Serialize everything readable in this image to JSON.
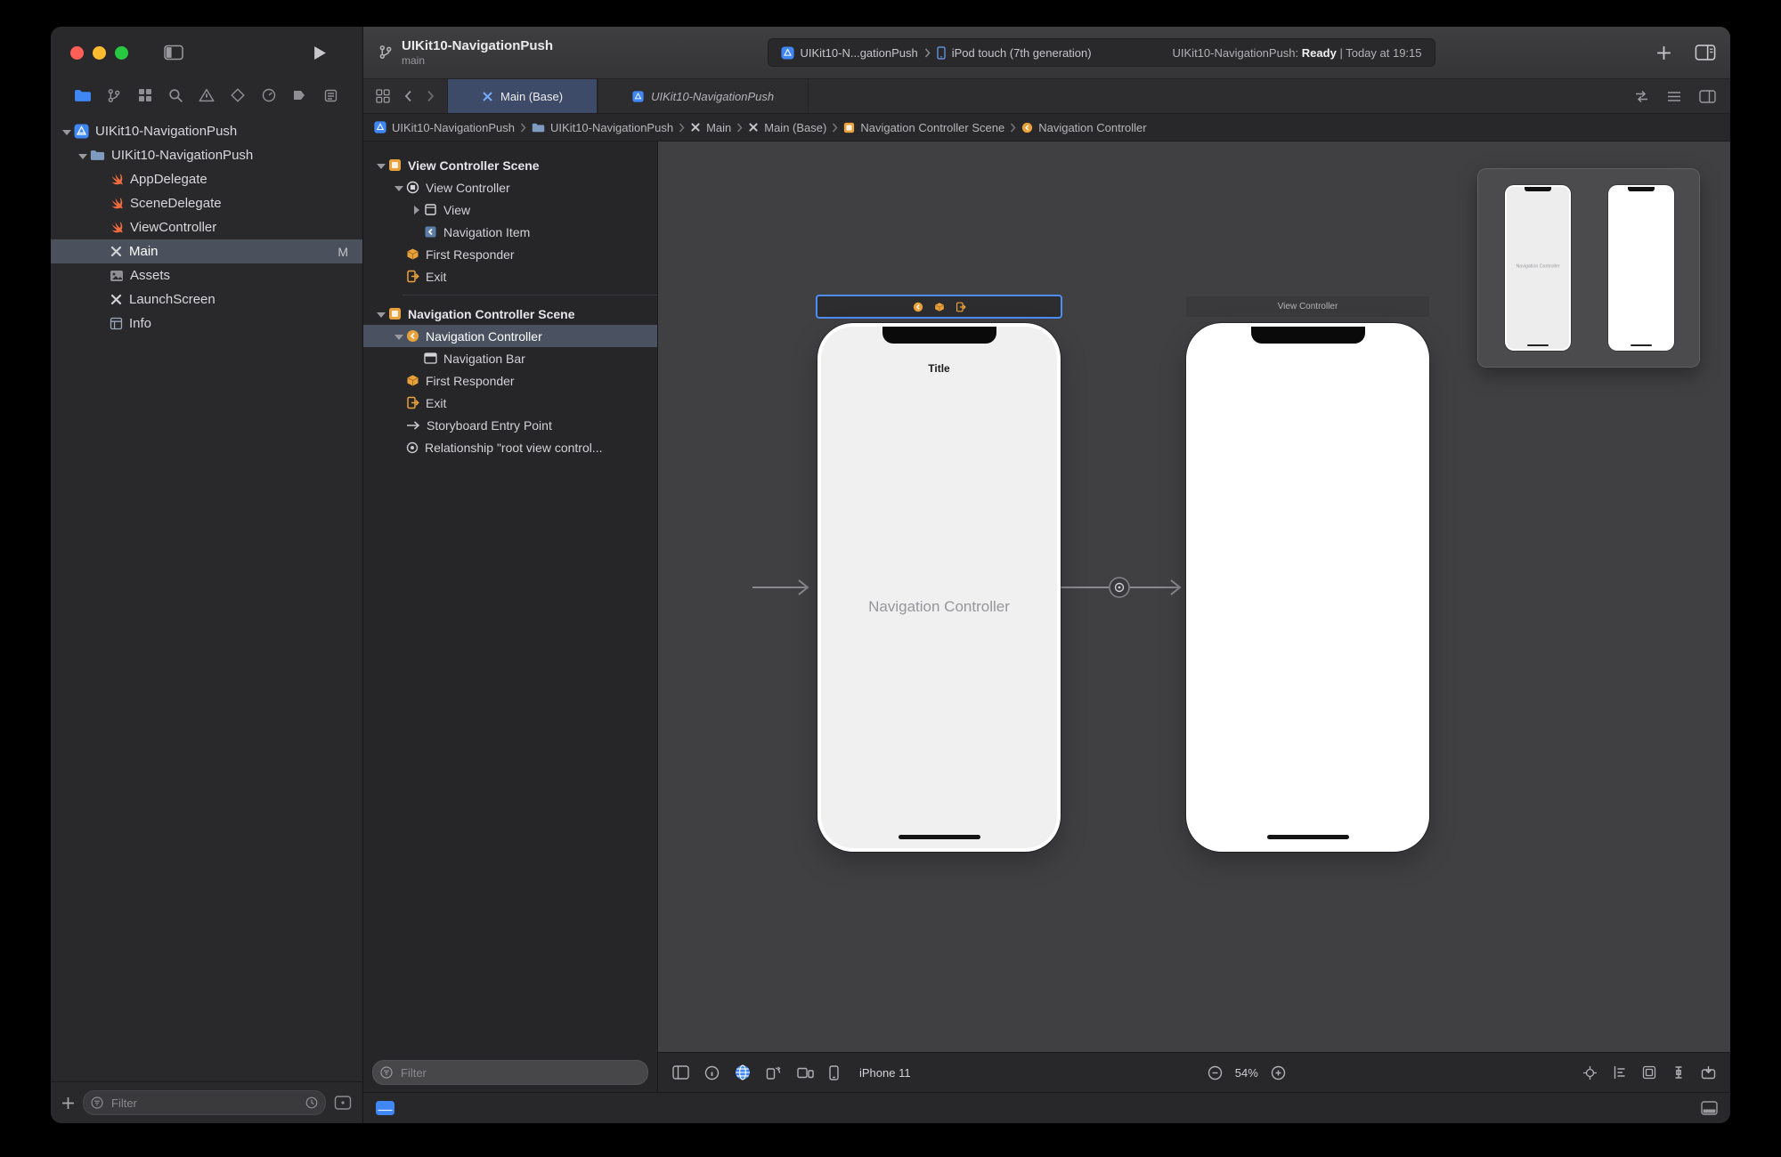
{
  "colors": {
    "accent_blue": "#3f87f5",
    "xcode_orange": "#e9a23b",
    "selection_blue": "#4d8df6",
    "swift_orange": "#f26b3e"
  },
  "sidebar": {
    "navigator_tabs": [
      "project-navigator-icon",
      "source-control-navigator-icon",
      "symbol-navigator-icon",
      "find-navigator-icon",
      "issue-navigator-icon",
      "test-navigator-icon",
      "debug-navigator-icon",
      "breakpoint-navigator-icon",
      "report-navigator-icon"
    ],
    "tree": [
      {
        "label": "UIKit10-NavigationPush",
        "icon": "xcode-project-icon"
      },
      {
        "label": "UIKit10-NavigationPush",
        "icon": "folder-icon"
      },
      {
        "label": "AppDelegate",
        "icon": "swift-file-icon"
      },
      {
        "label": "SceneDelegate",
        "icon": "swift-file-icon"
      },
      {
        "label": "ViewController",
        "icon": "swift-file-icon"
      },
      {
        "label": "Main",
        "icon": "storyboard-file-icon",
        "badge": "M",
        "selected": true
      },
      {
        "label": "Assets",
        "icon": "asset-catalog-icon"
      },
      {
        "label": "LaunchScreen",
        "icon": "storyboard-file-icon"
      },
      {
        "label": "Info",
        "icon": "plist-file-icon"
      }
    ],
    "filter_placeholder": "Filter"
  },
  "toolbar": {
    "title": "UIKit10-NavigationPush",
    "subtitle": "main",
    "scheme": "UIKit10-N...gationPush",
    "run_destination": "iPod touch (7th generation)",
    "activity_project": "UIKit10-NavigationPush:",
    "activity_status": "Ready",
    "activity_divider": "|",
    "activity_time": "Today at 19:15"
  },
  "tabbar": {
    "tabs": [
      {
        "label": "Main (Base)",
        "icon": "storyboard-file-icon",
        "active": true
      },
      {
        "label": "UIKit10-NavigationPush",
        "icon": "project-file-icon",
        "italic": true
      }
    ]
  },
  "jumpbar": {
    "crumbs": [
      {
        "label": "UIKit10-NavigationPush",
        "icon": "xcode-project-icon"
      },
      {
        "label": "UIKit10-NavigationPush",
        "icon": "folder-icon"
      },
      {
        "label": "Main",
        "icon": "storyboard-file-icon"
      },
      {
        "label": "Main (Base)",
        "icon": "storyboard-file-icon"
      },
      {
        "label": "Navigation Controller Scene",
        "icon": "scene-icon"
      },
      {
        "label": "Navigation Controller",
        "icon": "navigation-controller-icon"
      }
    ]
  },
  "outline": {
    "rows": [
      {
        "label": "View Controller Scene",
        "icon": "scene-icon"
      },
      {
        "label": "View Controller",
        "icon": "view-controller-icon"
      },
      {
        "label": "View",
        "icon": "view-icon"
      },
      {
        "label": "Navigation Item",
        "icon": "navigation-item-icon"
      },
      {
        "label": "First Responder",
        "icon": "first-responder-icon"
      },
      {
        "label": "Exit",
        "icon": "exit-icon"
      },
      {
        "label": "Navigation Controller Scene",
        "icon": "scene-icon"
      },
      {
        "label": "Navigation Controller",
        "icon": "navigation-controller-icon",
        "selected": true
      },
      {
        "label": "Navigation Bar",
        "icon": "navigation-bar-icon"
      },
      {
        "label": "First Responder",
        "icon": "first-responder-icon"
      },
      {
        "label": "Exit",
        "icon": "exit-icon"
      },
      {
        "label": "Storyboard Entry Point",
        "icon": "entry-point-icon"
      },
      {
        "label": "Relationship \"root view control...",
        "icon": "relationship-icon"
      }
    ],
    "filter_placeholder": "Filter"
  },
  "canvas": {
    "nav_scene": {
      "nav_bar_title": "Title",
      "body_label": "Navigation Controller"
    },
    "vc_scene": {
      "header_label": "View Controller"
    },
    "minimap": {
      "nav_label": "Navigation Controller"
    }
  },
  "status_bar": {
    "device": "iPhone 11",
    "zoom": "54%"
  }
}
